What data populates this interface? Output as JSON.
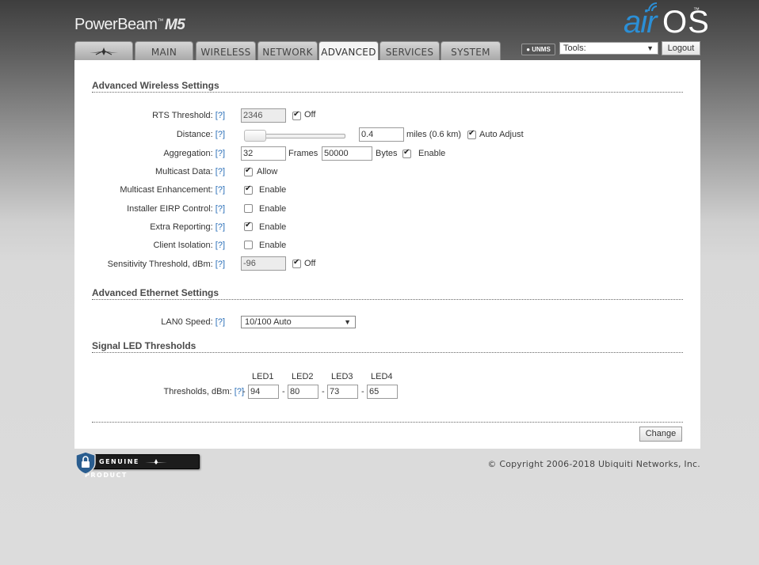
{
  "header": {
    "product_name": "PowerBeam",
    "product_tm": "™",
    "product_model": "M5",
    "brand_air": "air",
    "brand_os": "OS",
    "brand_tm": "™"
  },
  "tabs": [
    {
      "label": ""
    },
    {
      "label": "MAIN"
    },
    {
      "label": "WIRELESS"
    },
    {
      "label": "NETWORK"
    },
    {
      "label": "ADVANCED",
      "active": true
    },
    {
      "label": "SERVICES"
    },
    {
      "label": "SYSTEM"
    }
  ],
  "topbar": {
    "unms_label": "UNMS",
    "tools_value": "Tools:",
    "logout_label": "Logout"
  },
  "wireless": {
    "title": "Advanced Wireless Settings",
    "help": "[?]",
    "rts": {
      "label": "RTS Threshold:",
      "value": "2346",
      "check_label": "Off",
      "checked": true
    },
    "distance": {
      "label": "Distance:",
      "value": "0.4",
      "unit": "miles (0.6 km)",
      "check_label": "Auto Adjust",
      "checked": true
    },
    "aggregation": {
      "label": "Aggregation:",
      "frames_value": "32",
      "frames_label": "Frames",
      "bytes_value": "50000",
      "bytes_label": "Bytes",
      "check_label": "Enable",
      "checked": true
    },
    "multicast_data": {
      "label": "Multicast Data:",
      "check_label": "Allow",
      "checked": true
    },
    "multicast_enh": {
      "label": "Multicast Enhancement:",
      "check_label": "Enable",
      "checked": true
    },
    "eirp": {
      "label": "Installer EIRP Control:",
      "check_label": "Enable",
      "checked": false
    },
    "extra_reporting": {
      "label": "Extra Reporting:",
      "check_label": "Enable",
      "checked": true
    },
    "client_isolation": {
      "label": "Client Isolation:",
      "check_label": "Enable",
      "checked": false
    },
    "sensitivity": {
      "label": "Sensitivity Threshold, dBm:",
      "value": "-96",
      "check_label": "Off",
      "checked": true
    }
  },
  "ethernet": {
    "title": "Advanced Ethernet Settings",
    "lan0": {
      "label": "LAN0 Speed:",
      "value": "10/100 Auto"
    }
  },
  "led": {
    "title": "Signal LED Thresholds",
    "label": "Thresholds, dBm:",
    "dash": "-",
    "headers": [
      "LED1",
      "LED2",
      "LED3",
      "LED4"
    ],
    "values": [
      "94",
      "80",
      "73",
      "65"
    ]
  },
  "change_label": "Change",
  "footer": {
    "badge_left": "GENUINE",
    "badge_right": "PRODUCT",
    "copyright": "© Copyright 2006-2018 Ubiquiti Networks, Inc."
  }
}
